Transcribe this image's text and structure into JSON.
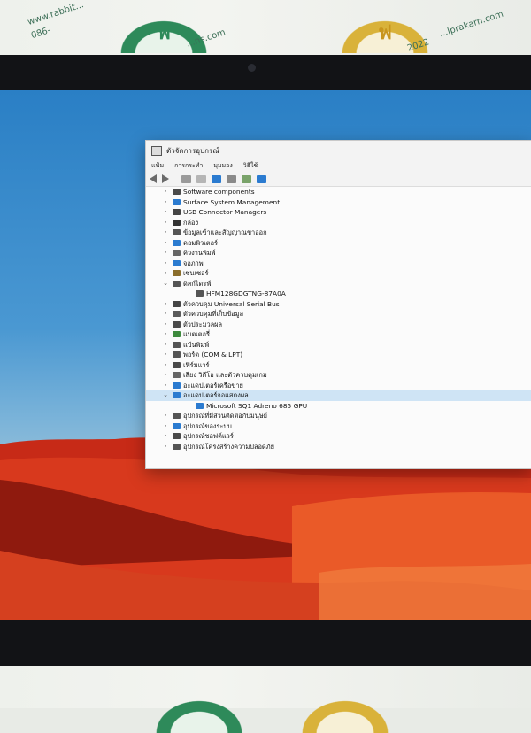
{
  "window": {
    "title": "ตัวจัดการอุปกรณ์",
    "menu": [
      "แฟ้ม",
      "การกระทำ",
      "มุมมอง",
      "วิธีใช้"
    ]
  },
  "device_tree": [
    {
      "label": "Software components",
      "expanded": false,
      "icon": "chip-icon",
      "color": "#4a4a4a",
      "level": 0
    },
    {
      "label": "Surface System Management",
      "expanded": false,
      "icon": "monitor-icon",
      "color": "#2b7bd0",
      "level": 0
    },
    {
      "label": "USB Connector Managers",
      "expanded": false,
      "icon": "usb-icon",
      "color": "#444444",
      "level": 0
    },
    {
      "label": "กล้อง",
      "expanded": false,
      "icon": "camera-icon",
      "color": "#333333",
      "level": 0
    },
    {
      "label": "ข้อมูลเข้าและสัญญาณขาออก",
      "expanded": false,
      "icon": "speaker-icon",
      "color": "#555555",
      "level": 0
    },
    {
      "label": "คอมพิวเตอร์",
      "expanded": false,
      "icon": "monitor-icon",
      "color": "#2b7bd0",
      "level": 0
    },
    {
      "label": "คิวงานพิมพ์",
      "expanded": false,
      "icon": "printer-icon",
      "color": "#666666",
      "level": 0
    },
    {
      "label": "จอภาพ",
      "expanded": false,
      "icon": "monitor-icon",
      "color": "#2b7bd0",
      "level": 0
    },
    {
      "label": "เซนเซอร์",
      "expanded": false,
      "icon": "sensor-icon",
      "color": "#8a6d2b",
      "level": 0
    },
    {
      "label": "ดิสก์ไดรฟ์",
      "expanded": true,
      "icon": "drive-icon",
      "color": "#555555",
      "level": 0
    },
    {
      "label": "HFM128GDGTNG-87A0A",
      "expanded": null,
      "icon": "drive-icon",
      "color": "#555555",
      "level": 1
    },
    {
      "label": "ตัวควบคุม Universal Serial Bus",
      "expanded": false,
      "icon": "usb-icon",
      "color": "#444444",
      "level": 0
    },
    {
      "label": "ตัวควบคุมที่เก็บข้อมูล",
      "expanded": false,
      "icon": "storage-icon",
      "color": "#5a5a5a",
      "level": 0
    },
    {
      "label": "ตัวประมวลผล",
      "expanded": false,
      "icon": "chip-icon",
      "color": "#4a4a4a",
      "level": 0
    },
    {
      "label": "แบตเตอรี่",
      "expanded": false,
      "icon": "battery-icon",
      "color": "#3d8a3d",
      "level": 0
    },
    {
      "label": "แป้นพิมพ์",
      "expanded": false,
      "icon": "keyboard-icon",
      "color": "#555555",
      "level": 0
    },
    {
      "label": "พอร์ต (COM & LPT)",
      "expanded": false,
      "icon": "port-icon",
      "color": "#555555",
      "level": 0
    },
    {
      "label": "เฟิร์มแวร์",
      "expanded": false,
      "icon": "chip-icon",
      "color": "#4a4a4a",
      "level": 0
    },
    {
      "label": "เสียง วิดีโอ และตัวควบคุมเกม",
      "expanded": false,
      "icon": "speaker-icon",
      "color": "#666666",
      "level": 0
    },
    {
      "label": "อะแดปเตอร์เครือข่าย",
      "expanded": false,
      "icon": "network-icon",
      "color": "#2b7bd0",
      "level": 0
    },
    {
      "label": "อะแดปเตอร์จอแสดงผล",
      "expanded": true,
      "icon": "monitor-icon",
      "color": "#2b7bd0",
      "level": 0,
      "selected": true
    },
    {
      "label": "Microsoft SQ1 Adreno 685 GPU",
      "expanded": null,
      "icon": "monitor-icon",
      "color": "#2b7bd0",
      "level": 1
    },
    {
      "label": "อุปกรณ์ที่มีส่วนติดต่อกับมนุษย์",
      "expanded": false,
      "icon": "hid-icon",
      "color": "#555555",
      "level": 0
    },
    {
      "label": "อุปกรณ์ของระบบ",
      "expanded": false,
      "icon": "system-icon",
      "color": "#2b7bd0",
      "level": 0
    },
    {
      "label": "อุปกรณ์ซอฟต์แวร์",
      "expanded": false,
      "icon": "chip-icon",
      "color": "#4a4a4a",
      "level": 0
    },
    {
      "label": "อุปกรณ์โครงสร้างความปลอดภัย",
      "expanded": false,
      "icon": "shield-icon",
      "color": "#555555",
      "level": 0
    }
  ],
  "taskbar": {
    "items": [
      "windows-start-icon",
      "search-icon",
      "task-view-icon",
      "chat-icon",
      "file-explorer-icon",
      "edge-icon",
      "store-icon",
      "device-manager-icon"
    ],
    "tray": [
      "chevron-up-icon",
      "keyboard-icon"
    ]
  },
  "watermark": {
    "left_text": "www.rabbit...",
    "mid_text": "...ns.com",
    "right_text": "...lprakarn.com",
    "phone_fragment": "086-",
    "year_fragment": "2022"
  },
  "colors": {
    "accent": "#2b7bd0",
    "selection": "#cfe4f5",
    "taskbar": "#25242d"
  }
}
